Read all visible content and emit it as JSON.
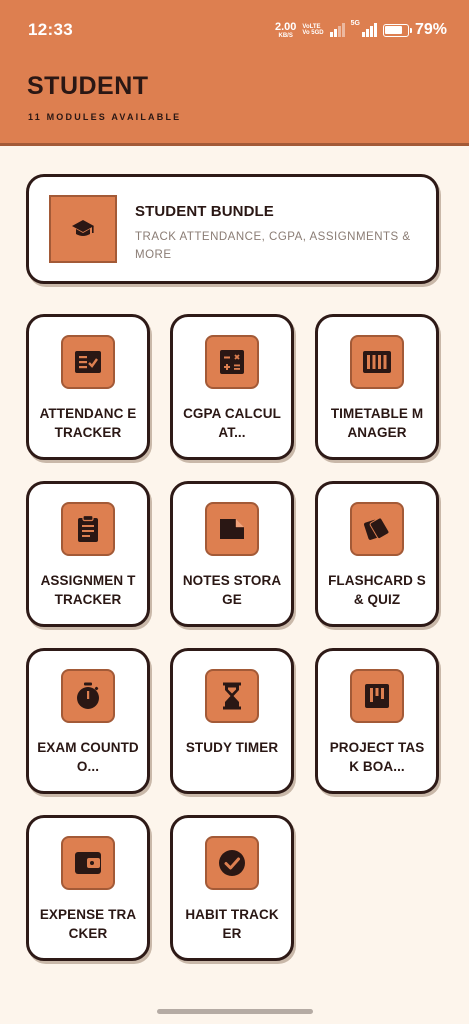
{
  "status_bar": {
    "time": "12:33",
    "net_speed_value": "2.00",
    "net_speed_unit": "KB/S",
    "volte_line1": "VoLTE",
    "volte_line2": "Vo 5GD",
    "network": "5G",
    "battery_percent": "79%"
  },
  "header": {
    "title": "STUDENT",
    "subtitle": "11 MODULES AVAILABLE"
  },
  "bundle": {
    "title": "STUDENT BUNDLE",
    "description": "TRACK ATTENDANCE, CGPA, ASSIGNMENTS & MORE",
    "icon": "graduation-cap-icon"
  },
  "modules": [
    {
      "label": "ATTENDANCE TRACKER",
      "display": "ATTENDANC E TRACKER",
      "icon": "checklist-icon"
    },
    {
      "label": "CGPA CALCULATOR",
      "display": "CGPA CALCULAT...",
      "icon": "calculator-icon"
    },
    {
      "label": "TIMETABLE MANAGER",
      "display": "TIMETABLE MANAGER",
      "icon": "timetable-icon"
    },
    {
      "label": "ASSIGNMENT TRACKER",
      "display": "ASSIGNMEN T TRACKER",
      "icon": "clipboard-icon"
    },
    {
      "label": "NOTES STORAGE",
      "display": "NOTES STORAGE",
      "icon": "note-icon"
    },
    {
      "label": "FLASHCARDS & QUIZ",
      "display": "FLASHCARD S & QUIZ",
      "icon": "flashcards-icon"
    },
    {
      "label": "EXAM COUNTDOWN",
      "display": "EXAM COUNTDO...",
      "icon": "stopwatch-icon"
    },
    {
      "label": "STUDY TIMER",
      "display": "STUDY TIMER",
      "icon": "hourglass-icon"
    },
    {
      "label": "PROJECT TASK BOARD",
      "display": "PROJECT TASK BOA...",
      "icon": "kanban-icon"
    },
    {
      "label": "EXPENSE TRACKER",
      "display": "EXPENSE TRACKER",
      "icon": "wallet-icon"
    },
    {
      "label": "HABIT TRACKER",
      "display": "HABIT TRACKER",
      "icon": "check-circle-icon"
    }
  ],
  "colors": {
    "accent": "#dd7f50",
    "accent_border": "#a35a37",
    "background": "#fdf5ec",
    "ink": "#2a1714",
    "muted_text": "#8a7c74"
  }
}
